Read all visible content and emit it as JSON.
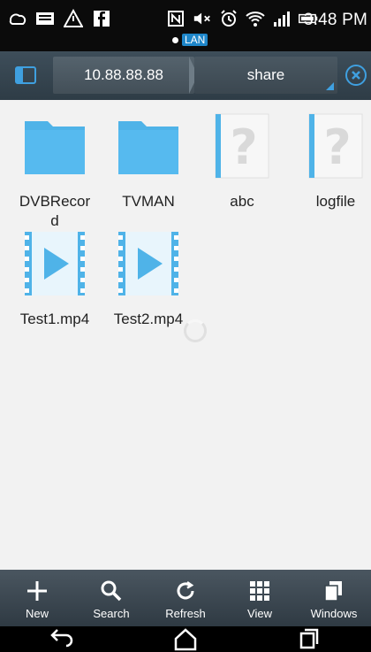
{
  "status_bar": {
    "time": "3:48 PM",
    "network_label": "LAN",
    "left_icons": [
      "sync-icon",
      "message-icon",
      "alert-icon",
      "facebook-icon"
    ],
    "right_icons": [
      "nfc-icon",
      "mute-icon",
      "alarm-icon",
      "wifi-icon",
      "signal-icon",
      "battery-icon"
    ]
  },
  "address_bar": {
    "crumbs": [
      "10.88.88.88",
      "share"
    ]
  },
  "files": [
    {
      "name": "DVBRecor\nd",
      "type": "folder"
    },
    {
      "name": "TVMAN",
      "type": "folder"
    },
    {
      "name": "abc",
      "type": "unknown"
    },
    {
      "name": "logfile",
      "type": "unknown"
    },
    {
      "name": "Test1.mp4",
      "type": "video"
    },
    {
      "name": "Test2.mp4",
      "type": "video"
    }
  ],
  "toolbar": {
    "new_label": "New",
    "search_label": "Search",
    "refresh_label": "Refresh",
    "view_label": "View",
    "windows_label": "Windows"
  },
  "colors": {
    "folder": "#4fb3e8",
    "accent": "#3fa0e0",
    "toolbar_bg": "#37434c"
  }
}
